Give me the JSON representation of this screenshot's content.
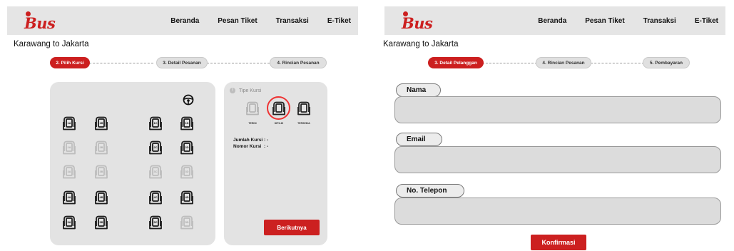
{
  "brand": {
    "logo_text": "Bus",
    "accent": "#cc1f1f"
  },
  "nav": {
    "items": [
      "Beranda",
      "Pesan Tiket",
      "Transaksi",
      "E-Tiket"
    ]
  },
  "route": "Karawang to Jakarta",
  "seat_page": {
    "steps": [
      "2. Pilih Kursi",
      "3. Detail Pesanan",
      "4. Rincian Pesanan"
    ],
    "active_step": 0,
    "seats": [
      {
        "label": "1A",
        "status": "available"
      },
      {
        "label": "1B",
        "status": "available"
      },
      {
        "label": "1C",
        "status": "available"
      },
      {
        "label": "1D",
        "status": "available"
      },
      {
        "label": "2A",
        "status": "filled"
      },
      {
        "label": "2B",
        "status": "filled"
      },
      {
        "label": "2C",
        "status": "available"
      },
      {
        "label": "2D",
        "status": "available"
      },
      {
        "label": "3A",
        "status": "filled"
      },
      {
        "label": "3B",
        "status": "filled"
      },
      {
        "label": "3C",
        "status": "filled"
      },
      {
        "label": "3D",
        "status": "filled"
      },
      {
        "label": "4A",
        "status": "available"
      },
      {
        "label": "4B",
        "status": "available"
      },
      {
        "label": "4C",
        "status": "available"
      },
      {
        "label": "4D",
        "status": "available"
      },
      {
        "label": "5A",
        "status": "available"
      },
      {
        "label": "5B",
        "status": "available"
      },
      {
        "label": "5C",
        "status": "available"
      },
      {
        "label": "5D",
        "status": "filled"
      }
    ],
    "legend": {
      "title": "Tipe Kursi",
      "items": [
        {
          "label": "TERISI",
          "icon": "seat-filled-icon"
        },
        {
          "label": "DIPILIH",
          "icon": "seat-selected-icon"
        },
        {
          "label": "TERSEDIA",
          "icon": "seat-available-icon"
        }
      ],
      "jumlah_kursi": "Jumlah Kursi : -",
      "nomor_kursi": "Nomor Kursi  : -"
    },
    "next_button": "Berikutnya",
    "steering_icon": "steering-wheel-icon"
  },
  "customer_page": {
    "steps": [
      "3. Detail Pelanggan",
      "4. Rincian Pesanan",
      "5. Pembayaran"
    ],
    "active_step": 0,
    "fields": [
      {
        "label": "Nama",
        "value": ""
      },
      {
        "label": "Email",
        "value": ""
      },
      {
        "label": "No. Telepon",
        "value": ""
      }
    ],
    "confirm_button": "Konfirmasi"
  }
}
